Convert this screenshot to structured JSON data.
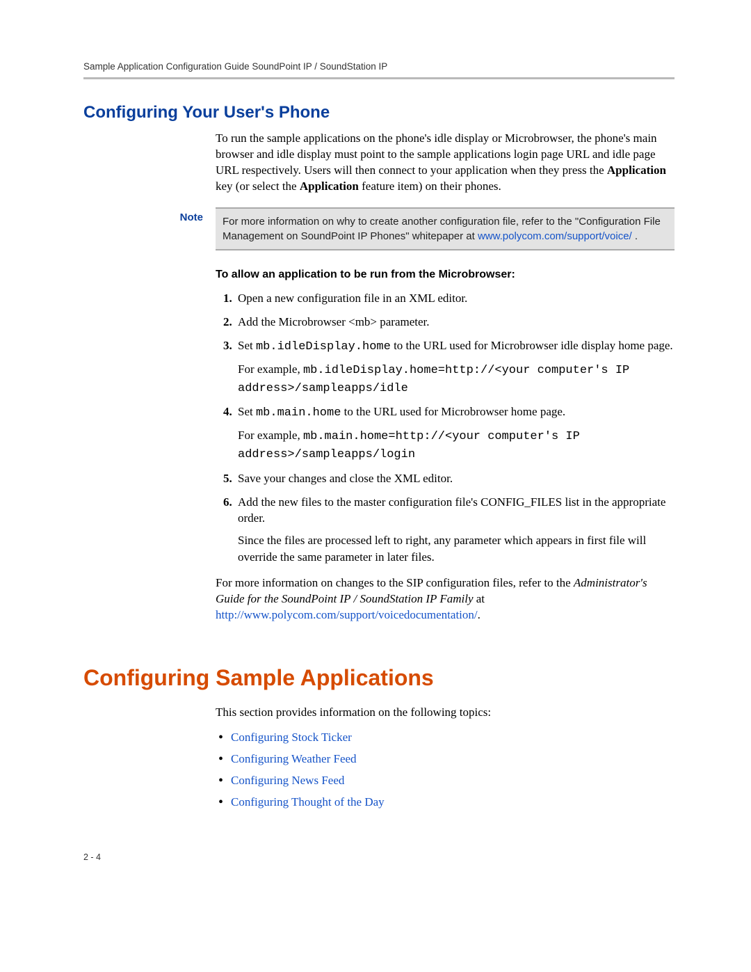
{
  "header": {
    "running": "Sample Application Configuration Guide SoundPoint IP / SoundStation IP"
  },
  "section1": {
    "title": "Configuring Your User's Phone",
    "intro_before_bold1": "To run the sample applications on the phone's idle display or Microbrowser, the phone's main browser and idle display must point to the sample applications login page URL and idle page URL respectively. Users will then connect to your application when they press the ",
    "bold1": "Application",
    "intro_mid": " key (or select the ",
    "bold2": "Application",
    "intro_after": " feature item) on their phones."
  },
  "note": {
    "label": "Note",
    "text_before_link": "For more information on why to create another configuration file, refer to the \"Configuration File Management on SoundPoint IP Phones\" whitepaper at ",
    "link": "www.polycom.com/support/voice/",
    "after": " ."
  },
  "procedure": {
    "title": "To allow an application to be run from the Microbrowser:",
    "steps": {
      "s1": "Open a new configuration file in an XML editor.",
      "s2": "Add the Microbrowser <mb> parameter.",
      "s3_a": "Set ",
      "s3_code1": "mb.idleDisplay.home",
      "s3_b": " to the URL used for Microbrowser idle display home page.",
      "s3_ex_a": "For example, ",
      "s3_ex_code": "mb.idleDisplay.home=http://<your computer's IP address>/sampleapps/idle",
      "s4_a": "Set ",
      "s4_code1": "mb.main.home",
      "s4_b": " to the URL used for Microbrowser home page.",
      "s4_ex_a": "For example, ",
      "s4_ex_code": "mb.main.home=http://<your computer's IP address>/sampleapps/login",
      "s5": "Save your changes and close the XML editor.",
      "s6": "Add the new files to the master configuration file's CONFIG_FILES list in the appropriate order.",
      "s6_sub": "Since the files are processed left to right, any parameter which appears in first file will override the same parameter in later files."
    },
    "trailing_a": "For more information on changes to the SIP configuration files, refer to the ",
    "trailing_italic": "Administrator's Guide for the SoundPoint IP / SoundStation IP Family",
    "trailing_b": " at ",
    "trailing_link": "http://www.polycom.com/support/voicedocumentation/",
    "trailing_dot": "."
  },
  "section2": {
    "title": "Configuring Sample Applications",
    "intro": "This section provides information on the following topics:",
    "links": {
      "l1": "Configuring Stock Ticker",
      "l2": "Configuring Weather Feed",
      "l3": "Configuring News Feed",
      "l4": "Configuring Thought of the Day"
    }
  },
  "footer": {
    "page": "2 - 4"
  }
}
